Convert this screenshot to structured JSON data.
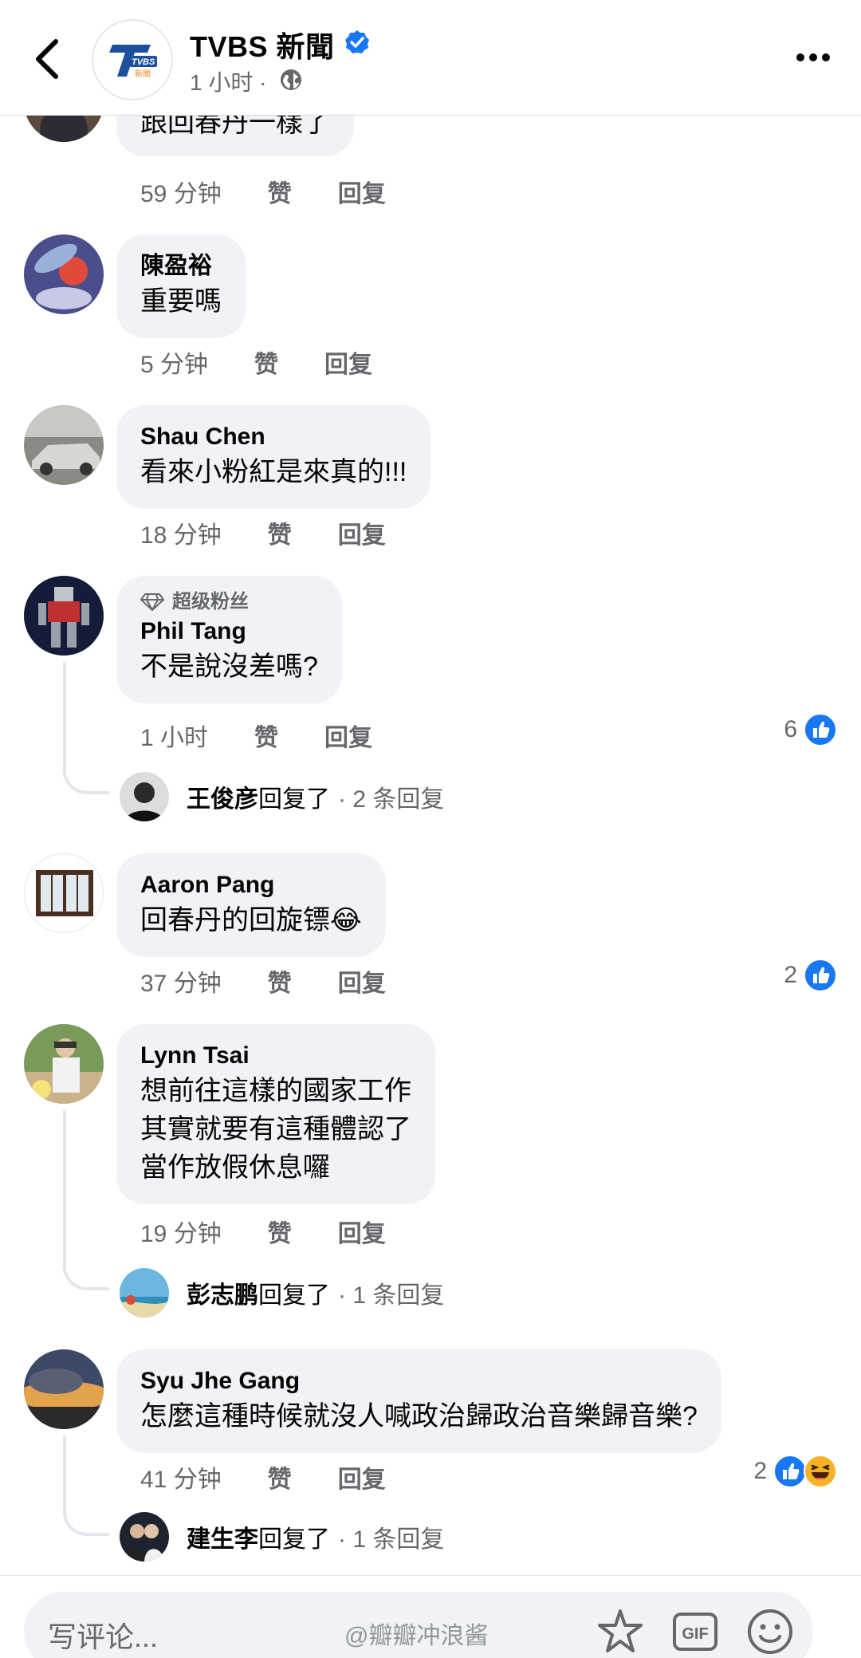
{
  "header": {
    "page_name": "TVBS 新聞",
    "post_time": "1 小时 ·",
    "logo_text": "TVBS",
    "logo_sub": "新聞"
  },
  "comments": [
    {
      "id": "c0",
      "text": "跟回春丹一樣了",
      "time": "59 分钟",
      "like": "赞",
      "reply": "回复"
    },
    {
      "id": "c1",
      "author": "陳盈裕",
      "text": "重要嗎",
      "time": "5 分钟",
      "like": "赞",
      "reply": "回复"
    },
    {
      "id": "c2",
      "author": "Shau Chen",
      "text": "看來小粉紅是來真的!!!",
      "time": "18 分钟",
      "like": "赞",
      "reply": "回复"
    },
    {
      "id": "c3",
      "badge": "超级粉丝",
      "author": "Phil Tang",
      "text": "不是說沒差嗎?",
      "time": "1 小时",
      "like": "赞",
      "reply": "回复",
      "reaction_count": "6",
      "reply_preview": {
        "name": "王俊彦",
        "action": "回复了",
        "count": "· 2 条回复"
      }
    },
    {
      "id": "c4",
      "author": "Aaron Pang",
      "text": "回春丹的回旋镖😂",
      "time": "37 分钟",
      "like": "赞",
      "reply": "回复",
      "reaction_count": "2"
    },
    {
      "id": "c5",
      "author": "Lynn Tsai",
      "text": "想前往這樣的國家工作\n其實就要有這種體認了\n當作放假休息囉",
      "time": "19 分钟",
      "like": "赞",
      "reply": "回复",
      "reply_preview": {
        "name": "彭志鹏",
        "action": "回复了",
        "count": "· 1 条回复"
      }
    },
    {
      "id": "c6",
      "author": "Syu Jhe Gang",
      "text": "怎麼這種時候就沒人喊政治歸政治音樂歸音樂?",
      "time": "41 分钟",
      "like": "赞",
      "reply": "回复",
      "reaction_count": "2",
      "reply_preview": {
        "name": "建生李",
        "action": "回复了",
        "count": "· 1 条回复"
      }
    }
  ],
  "composer": {
    "placeholder": "写评论...",
    "gif_label": "GIF"
  },
  "watermark": "@瓣瓣冲浪酱",
  "colors": {
    "facebook_blue": "#1877f2",
    "bubble_bg": "#f0f2f5",
    "secondary_text": "#65676b",
    "tvbs_orange": "#f08a24"
  },
  "icons": [
    "back-icon",
    "verified-icon",
    "globe-icon",
    "more-icon",
    "diamond-icon",
    "like-reaction-icon",
    "haha-reaction-icon",
    "sticker-icon",
    "gif-icon",
    "emoji-icon"
  ]
}
